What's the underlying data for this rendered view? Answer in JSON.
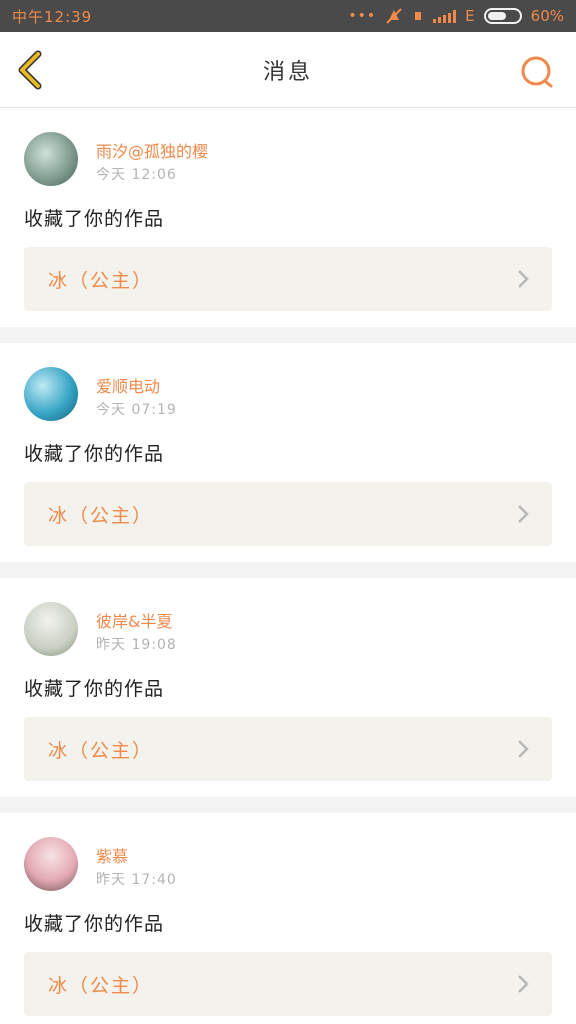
{
  "status": {
    "time": "中午12:39",
    "network": "E",
    "battery": "60%",
    "battery_level": 0.6
  },
  "header": {
    "title": "消息"
  },
  "messages": [
    {
      "user": "雨汐@孤独的樱",
      "time": "今天  12:06",
      "action": "收藏了你的作品",
      "work": "冰（公主）"
    },
    {
      "user": "爱顺电动",
      "time": "今天  07:19",
      "action": "收藏了你的作品",
      "work": "冰（公主）"
    },
    {
      "user": "彼岸&半夏",
      "time": "昨天  19:08",
      "action": "收藏了你的作品",
      "work": "冰（公主）"
    },
    {
      "user": "紫慕",
      "time": "昨天  17:40",
      "action": "收藏了你的作品",
      "work": "冰（公主）"
    }
  ],
  "colors": {
    "accent": "#f08a4b",
    "back_arrow": "#e9b923",
    "statusbar": "#4a4a4a",
    "card_bg": "#f3f2ec"
  },
  "icons": {
    "back": "back-arrow-icon",
    "search": "search-icon",
    "chevron": "chevron-right-icon"
  }
}
